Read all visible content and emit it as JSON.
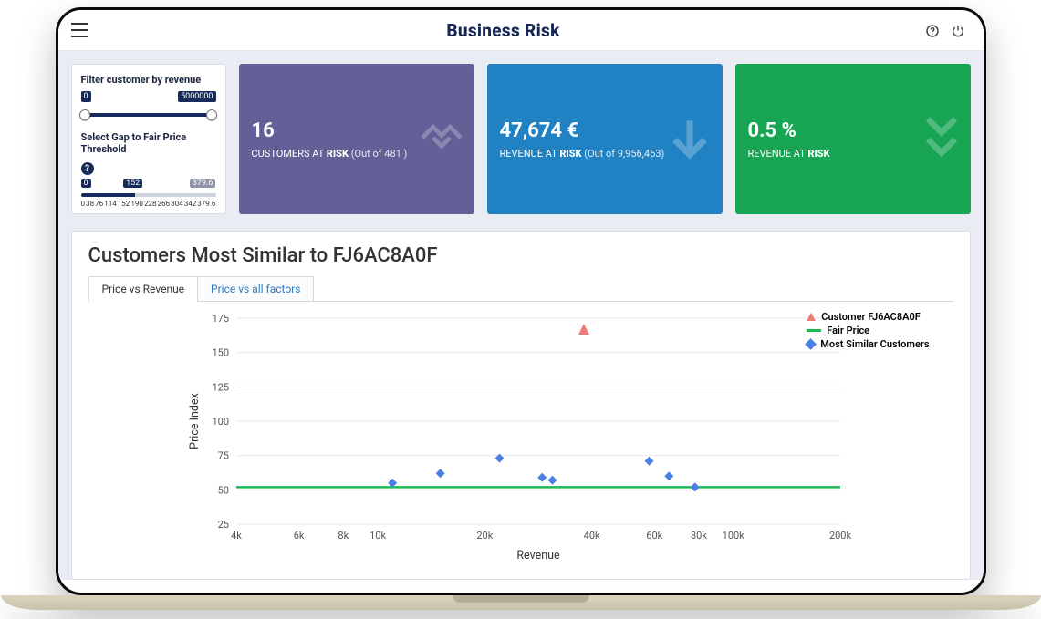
{
  "header": {
    "title": "Business Risk"
  },
  "filters": {
    "revenue": {
      "label": "Filter customer by revenue",
      "min": "0",
      "max": "5000000"
    },
    "gap": {
      "label": "Select Gap to Fair Price Threshold",
      "min": "0",
      "current": "152",
      "max": "379.6",
      "ticks": [
        "0",
        "38",
        "76",
        "114",
        "152",
        "190",
        "228",
        "266",
        "304",
        "342",
        "379.6"
      ]
    }
  },
  "kpi": {
    "customers": {
      "value": "16",
      "label_a": "CUSTOMERS AT",
      "label_b": "RISK",
      "label_c": "(Out of 481 )"
    },
    "revenue": {
      "value": "47,674 €",
      "label_a": "REVENUE AT",
      "label_b": "RISK",
      "label_c": "(Out of 9,956,453)"
    },
    "pct": {
      "value": "0.5 %",
      "label_a": "REVENUE AT",
      "label_b": "RISK"
    }
  },
  "panel": {
    "title": "Customers Most Similar to FJ6AC8A0F",
    "tabs": [
      "Price vs Revenue",
      "Price vs all factors"
    ],
    "legend": {
      "customer": "Customer FJ6AC8A0F",
      "fair": "Fair Price",
      "similar": "Most Similar Customers"
    }
  },
  "chart_data": {
    "type": "scatter",
    "xlabel": "Revenue",
    "ylabel": "Price Index",
    "x_scale": "log",
    "x_ticks": [
      4000,
      6000,
      8000,
      10000,
      20000,
      40000,
      60000,
      80000,
      100000,
      200000
    ],
    "x_tick_labels": [
      "4k",
      "6k",
      "8k",
      "10k",
      "20k",
      "40k",
      "60k",
      "80k",
      "100k",
      "200k"
    ],
    "y_ticks": [
      25,
      50,
      75,
      100,
      125,
      150,
      175
    ],
    "ylim": [
      25,
      175
    ],
    "series": [
      {
        "name": "Fair Price",
        "type": "line",
        "y": 52
      },
      {
        "name": "Customer FJ6AC8A0F",
        "type": "point-triangle",
        "points": [
          {
            "x": 38000,
            "y": 167
          }
        ]
      },
      {
        "name": "Most Similar Customers",
        "type": "point-diamond",
        "points": [
          {
            "x": 11000,
            "y": 55
          },
          {
            "x": 15000,
            "y": 62
          },
          {
            "x": 22000,
            "y": 73
          },
          {
            "x": 29000,
            "y": 59
          },
          {
            "x": 31000,
            "y": 57
          },
          {
            "x": 58000,
            "y": 71
          },
          {
            "x": 66000,
            "y": 60
          },
          {
            "x": 78000,
            "y": 52
          }
        ]
      }
    ]
  }
}
